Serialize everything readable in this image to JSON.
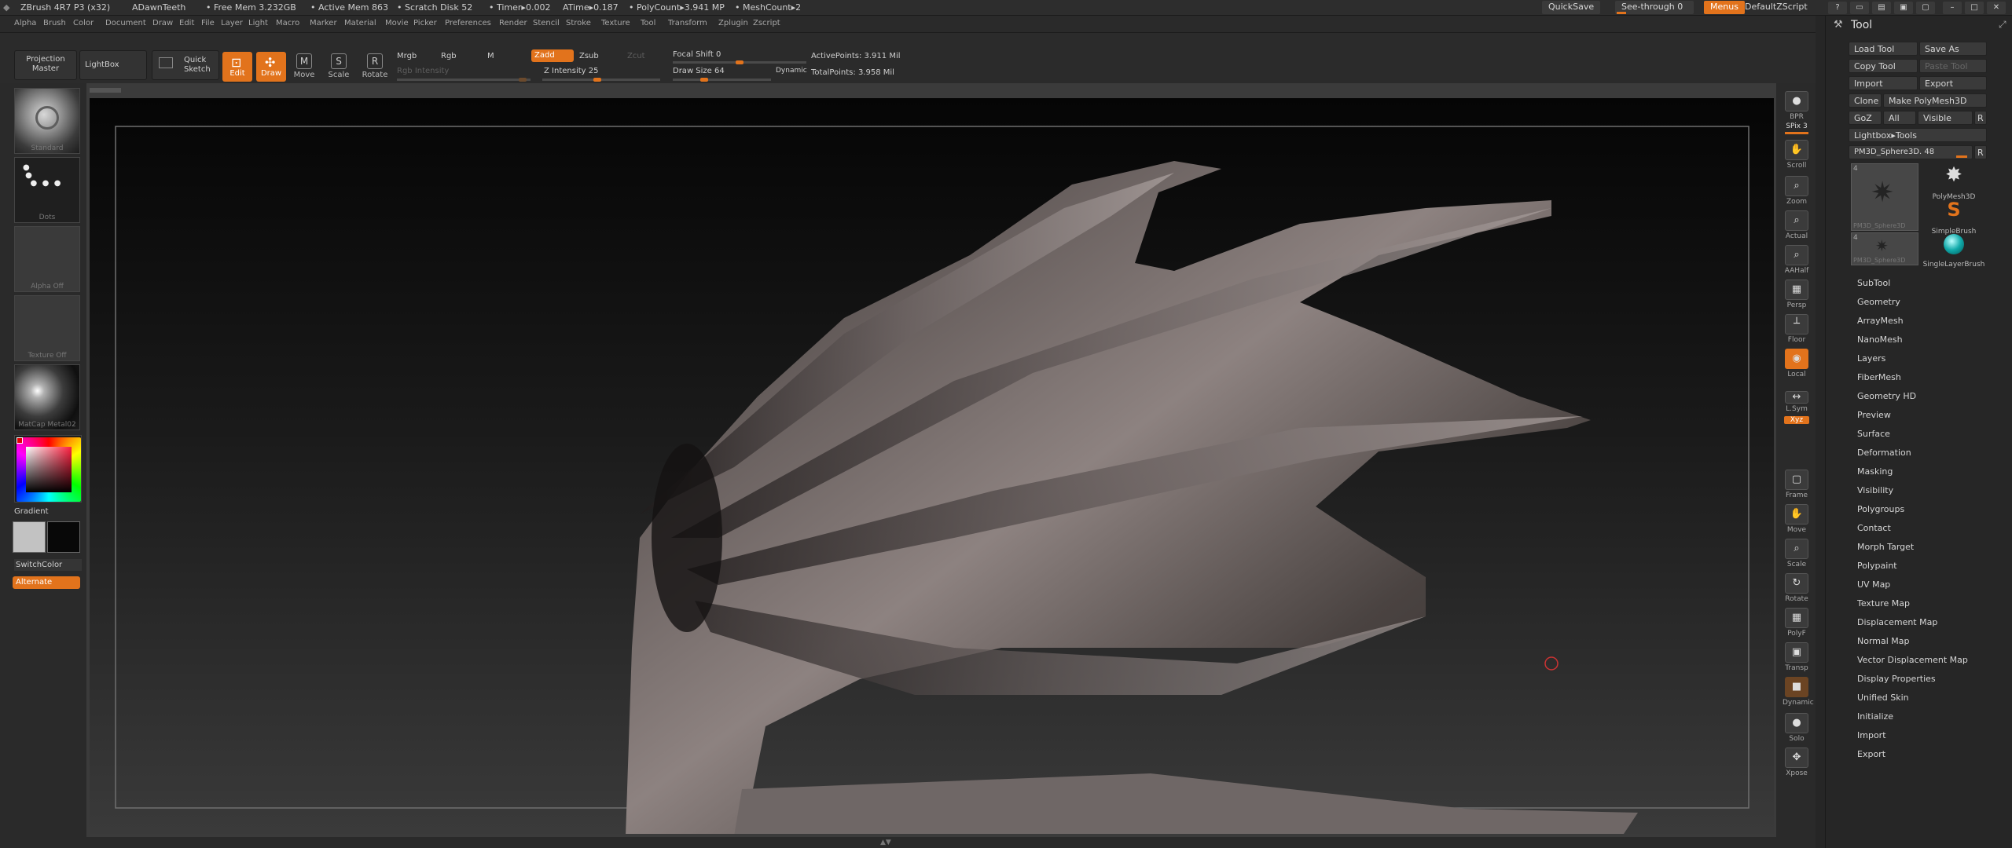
{
  "titlebar": {
    "app": "ZBrush 4R7 P3 (x32)",
    "document": "ADawnTeeth",
    "free_mem": "• Free Mem 3.232GB",
    "active_mem": "• Active Mem 863",
    "scratch": "• Scratch Disk 52",
    "timer": "• Timer▸0.002",
    "atime": "ATime▸0.187",
    "polycount": "• PolyCount▸3.941 MP",
    "meshcount": "• MeshCount▸2",
    "quicksave": "QuickSave",
    "see_through": "See-through",
    "see_through_value": "0",
    "menus": "Menus",
    "default_zscript": "DefaultZScript"
  },
  "menubar": [
    "Alpha",
    "Brush",
    "Color",
    "Document",
    "Draw",
    "Edit",
    "File",
    "Layer",
    "Light",
    "Macro",
    "Marker",
    "Material",
    "Movie",
    "Picker",
    "Preferences",
    "Render",
    "Stencil",
    "Stroke",
    "Texture",
    "Tool",
    "Transform",
    "Zplugin",
    "Zscript"
  ],
  "toolbar": {
    "projection_master": "Projection Master",
    "lightbox": "LightBox",
    "quick_sketch": "Quick Sketch",
    "edit": "Edit",
    "draw": "Draw",
    "move": "Move",
    "scale": "Scale",
    "rotate": "Rotate",
    "mrgb": "Mrgb",
    "rgb": "Rgb",
    "m": "M",
    "zadd": "Zadd",
    "zsub": "Zsub",
    "zcut": "Zcut",
    "rgb_intensity": "Rgb Intensity",
    "z_intensity": "Z Intensity 25",
    "focal_shift": "Focal Shift 0",
    "draw_size": "Draw Size 64",
    "dynamic": "Dynamic",
    "active_points": "ActivePoints: 3.911 Mil",
    "total_points": "TotalPoints: 3.958 Mil"
  },
  "leftshelf": {
    "brush": "Standard",
    "stroke": "Dots",
    "alpha": "Alpha Off",
    "texture": "Texture Off",
    "material": "MatCap Metal02",
    "gradient": "Gradient",
    "switch_color": "SwitchColor",
    "alternate": "Alternate"
  },
  "rightshelf": [
    {
      "name": "bpr",
      "label": "BPR",
      "glyph": "●"
    },
    {
      "name": "spix",
      "label": "SPix 3",
      "glyph": ""
    },
    {
      "name": "scroll",
      "label": "Scroll",
      "glyph": "✋"
    },
    {
      "name": "zoom",
      "label": "Zoom",
      "glyph": "⌕"
    },
    {
      "name": "actual",
      "label": "Actual",
      "glyph": "⌕"
    },
    {
      "name": "aahalf",
      "label": "AAHalf",
      "glyph": "⌕"
    },
    {
      "name": "persp",
      "label": "Persp",
      "glyph": "▦"
    },
    {
      "name": "floor",
      "label": "Floor",
      "glyph": "┴"
    },
    {
      "name": "local",
      "label": "Local",
      "glyph": "◉"
    },
    {
      "name": "lsym",
      "label": "L.Sym",
      "glyph": "↔"
    },
    {
      "name": "xyz",
      "label": "Xyz",
      "glyph": ""
    },
    {
      "name": "frame",
      "label": "Frame",
      "glyph": "▢"
    },
    {
      "name": "move",
      "label": "Move",
      "glyph": "✋"
    },
    {
      "name": "scale",
      "label": "Scale",
      "glyph": "⌕"
    },
    {
      "name": "rotate",
      "label": "Rotate",
      "glyph": "↻"
    },
    {
      "name": "polyf",
      "label": "PolyF",
      "glyph": "▦"
    },
    {
      "name": "transp",
      "label": "Transp",
      "glyph": "▣"
    },
    {
      "name": "dynamic",
      "label": "Dynamic",
      "glyph": "■"
    },
    {
      "name": "solo",
      "label": "Solo",
      "glyph": "●"
    },
    {
      "name": "xpose",
      "label": "Xpose",
      "glyph": "✥"
    }
  ],
  "tool_palette": {
    "title": "Tool",
    "load_tool": "Load Tool",
    "save_as": "Save As",
    "copy_tool": "Copy Tool",
    "paste_tool": "Paste Tool",
    "import": "Import",
    "export": "Export",
    "clone": "Clone",
    "make_polymesh": "Make PolyMesh3D",
    "goz": "GoZ",
    "all": "All",
    "visible": "Visible",
    "r": "R",
    "lightbox_tools": "Lightbox▸Tools",
    "current_tool": "PM3D_Sphere3D. 48",
    "thumbs": [
      {
        "label": "PM3D_Sphere3D",
        "count": "4"
      },
      {
        "label": "PolyMesh3D",
        "count": ""
      },
      {
        "label": "SimpleBrush",
        "count": ""
      },
      {
        "label": "PM3D_Sphere3D",
        "count": "4"
      },
      {
        "label": "SingleLayerBrush",
        "count": ""
      }
    ],
    "subpalettes": [
      "SubTool",
      "Geometry",
      "ArrayMesh",
      "NanoMesh",
      "Layers",
      "FiberMesh",
      "Geometry HD",
      "Preview",
      "Surface",
      "Deformation",
      "Masking",
      "Visibility",
      "Polygroups",
      "Contact",
      "Morph Target",
      "Polypaint",
      "UV Map",
      "Texture Map",
      "Displacement Map",
      "Normal Map",
      "Vector Displacement Map",
      "Display Properties",
      "Unified Skin",
      "Initialize",
      "Import",
      "Export"
    ]
  },
  "colors": {
    "accent": "#e2731c",
    "panel": "#2a2a2a",
    "bg": "#262626"
  }
}
